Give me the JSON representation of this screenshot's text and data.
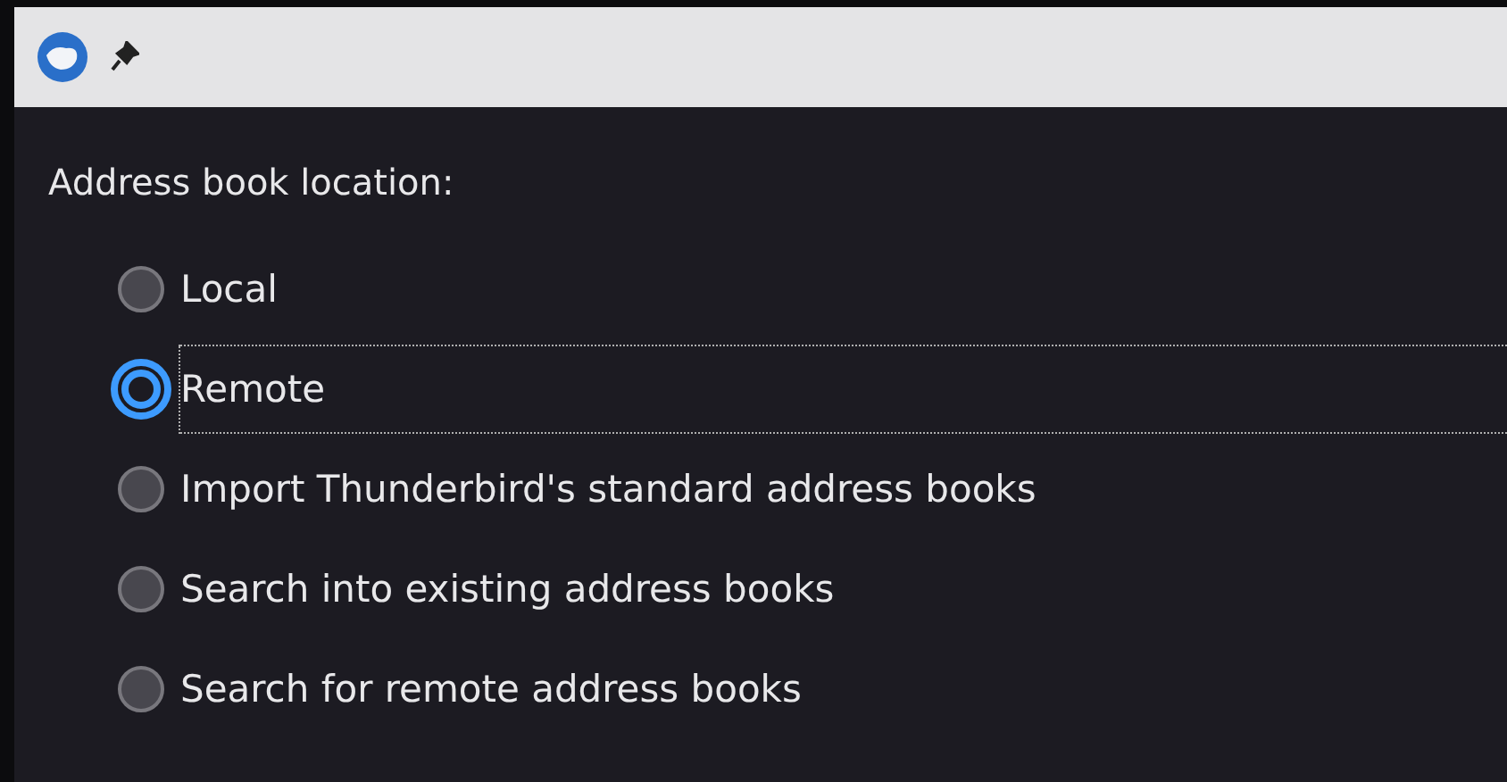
{
  "group": {
    "label": "Address book location:",
    "options": [
      {
        "label": "Local",
        "selected": false,
        "focused": false
      },
      {
        "label": "Remote",
        "selected": true,
        "focused": true
      },
      {
        "label": "Import Thunderbird's standard address books",
        "selected": false,
        "focused": false
      },
      {
        "label": "Search into existing address books",
        "selected": false,
        "focused": false
      },
      {
        "label": "Search for remote address books",
        "selected": false,
        "focused": false
      }
    ]
  }
}
